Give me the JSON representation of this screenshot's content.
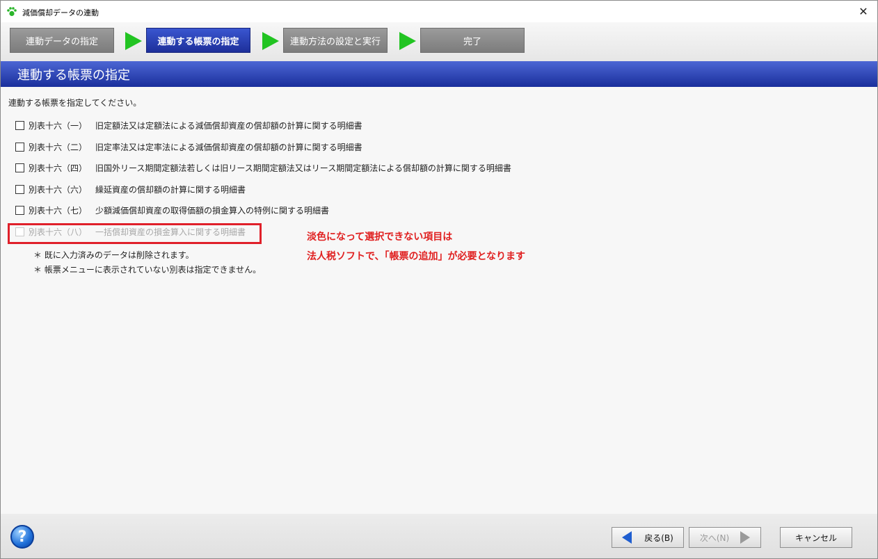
{
  "window": {
    "title": "減価償却データの連動",
    "close_label": "✕"
  },
  "steps": [
    {
      "label": "連動データの指定",
      "active": false
    },
    {
      "label": "連動する帳票の指定",
      "active": true
    },
    {
      "label": "連動方法の設定と実行",
      "active": false
    },
    {
      "label": "完了",
      "active": false
    }
  ],
  "header": {
    "title": "連動する帳票の指定"
  },
  "instruction": "連動する帳票を指定してください。",
  "options": [
    {
      "code": "別表十六（一）",
      "desc": "旧定額法又は定額法による減価償却資産の償却額の計算に関する明細書",
      "checked": false,
      "enabled": true
    },
    {
      "code": "別表十六（二）",
      "desc": "旧定率法又は定率法による減価償却資産の償却額の計算に関する明細書",
      "checked": false,
      "enabled": true
    },
    {
      "code": "別表十六（四）",
      "desc": "旧国外リース期間定額法若しくは旧リース期間定額法又はリース期間定額法による償却額の計算に関する明細書",
      "checked": false,
      "enabled": true
    },
    {
      "code": "別表十六（六）",
      "desc": "繰延資産の償却額の計算に関する明細書",
      "checked": false,
      "enabled": true
    },
    {
      "code": "別表十六（七）",
      "desc": "少額減価償却資産の取得価額の損金算入の特例に関する明細書",
      "checked": false,
      "enabled": true
    },
    {
      "code": "別表十六（八）",
      "desc": "一括償却資産の損金算入に関する明細書",
      "checked": false,
      "enabled": false
    }
  ],
  "notes": [
    "＊ 既に入力済みのデータは削除されます。",
    "＊ 帳票メニューに表示されていない別表は指定できません。"
  ],
  "annotation": {
    "line1": "淡色になって選択できない項目は",
    "line2": "法人税ソフトで、「帳票の追加」が必要となります",
    "color": "#e02020"
  },
  "footer": {
    "help_label": "?",
    "back_label": "戻る(B)",
    "next_label": "次へ(N)",
    "cancel_label": "キャンセル"
  },
  "colors": {
    "active_step": "#1d2f9a",
    "header_bar": "#2a40b0",
    "arrow": "#22c422",
    "highlight": "#e0202a"
  }
}
